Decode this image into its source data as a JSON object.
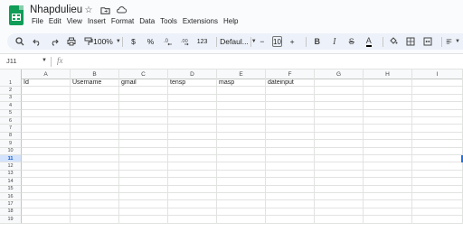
{
  "title_bar": {
    "doc_title": "Nhapdulieu",
    "icons": [
      "star-icon",
      "move-to-folder-icon",
      "cloud-status-icon"
    ]
  },
  "menu": [
    "File",
    "Edit",
    "View",
    "Insert",
    "Format",
    "Data",
    "Tools",
    "Extensions",
    "Help"
  ],
  "toolbar": {
    "zoom": "100%",
    "currency": "$",
    "percent": "%",
    "number_format": "123",
    "font": "Defaul...",
    "font_size": "10",
    "minus": "−",
    "plus": "+",
    "bold": "B",
    "italic": "I",
    "strikethrough": "S",
    "text_color": "A"
  },
  "formula_bar": {
    "name_box": "J11",
    "fx": "fx"
  },
  "columns": [
    "A",
    "B",
    "C",
    "D",
    "E",
    "F",
    "G",
    "H",
    "I"
  ],
  "rows": [
    {
      "n": "1",
      "cells": [
        "Id",
        "Username",
        "gmail",
        "tensp",
        "masp",
        "dateinput",
        "",
        "",
        ""
      ]
    },
    {
      "n": "2",
      "cells": [
        "",
        "",
        "",
        "",
        "",
        "",
        "",
        "",
        ""
      ]
    },
    {
      "n": "3",
      "cells": [
        "",
        "",
        "",
        "",
        "",
        "",
        "",
        "",
        ""
      ]
    },
    {
      "n": "4",
      "cells": [
        "",
        "",
        "",
        "",
        "",
        "",
        "",
        "",
        ""
      ]
    },
    {
      "n": "5",
      "cells": [
        "",
        "",
        "",
        "",
        "",
        "",
        "",
        "",
        ""
      ]
    },
    {
      "n": "6",
      "cells": [
        "",
        "",
        "",
        "",
        "",
        "",
        "",
        "",
        ""
      ]
    },
    {
      "n": "7",
      "cells": [
        "",
        "",
        "",
        "",
        "",
        "",
        "",
        "",
        ""
      ]
    },
    {
      "n": "8",
      "cells": [
        "",
        "",
        "",
        "",
        "",
        "",
        "",
        "",
        ""
      ]
    },
    {
      "n": "9",
      "cells": [
        "",
        "",
        "",
        "",
        "",
        "",
        "",
        "",
        ""
      ]
    },
    {
      "n": "10",
      "cells": [
        "",
        "",
        "",
        "",
        "",
        "",
        "",
        "",
        ""
      ]
    },
    {
      "n": "11",
      "cells": [
        "",
        "",
        "",
        "",
        "",
        "",
        "",
        "",
        ""
      ],
      "selected": true
    },
    {
      "n": "12",
      "cells": [
        "",
        "",
        "",
        "",
        "",
        "",
        "",
        "",
        ""
      ]
    },
    {
      "n": "13",
      "cells": [
        "",
        "",
        "",
        "",
        "",
        "",
        "",
        "",
        ""
      ]
    },
    {
      "n": "14",
      "cells": [
        "",
        "",
        "",
        "",
        "",
        "",
        "",
        "",
        ""
      ]
    },
    {
      "n": "15",
      "cells": [
        "",
        "",
        "",
        "",
        "",
        "",
        "",
        "",
        ""
      ]
    },
    {
      "n": "16",
      "cells": [
        "",
        "",
        "",
        "",
        "",
        "",
        "",
        "",
        ""
      ]
    },
    {
      "n": "17",
      "cells": [
        "",
        "",
        "",
        "",
        "",
        "",
        "",
        "",
        ""
      ]
    },
    {
      "n": "18",
      "cells": [
        "",
        "",
        "",
        "",
        "",
        "",
        "",
        "",
        ""
      ]
    },
    {
      "n": "19",
      "cells": [
        "",
        "",
        "",
        "",
        "",
        "",
        "",
        "",
        ""
      ]
    }
  ],
  "colors": {
    "accent": "#1a73e8",
    "sheets_green": "#0f9d58",
    "toolbar_bg": "#edf2fa"
  }
}
